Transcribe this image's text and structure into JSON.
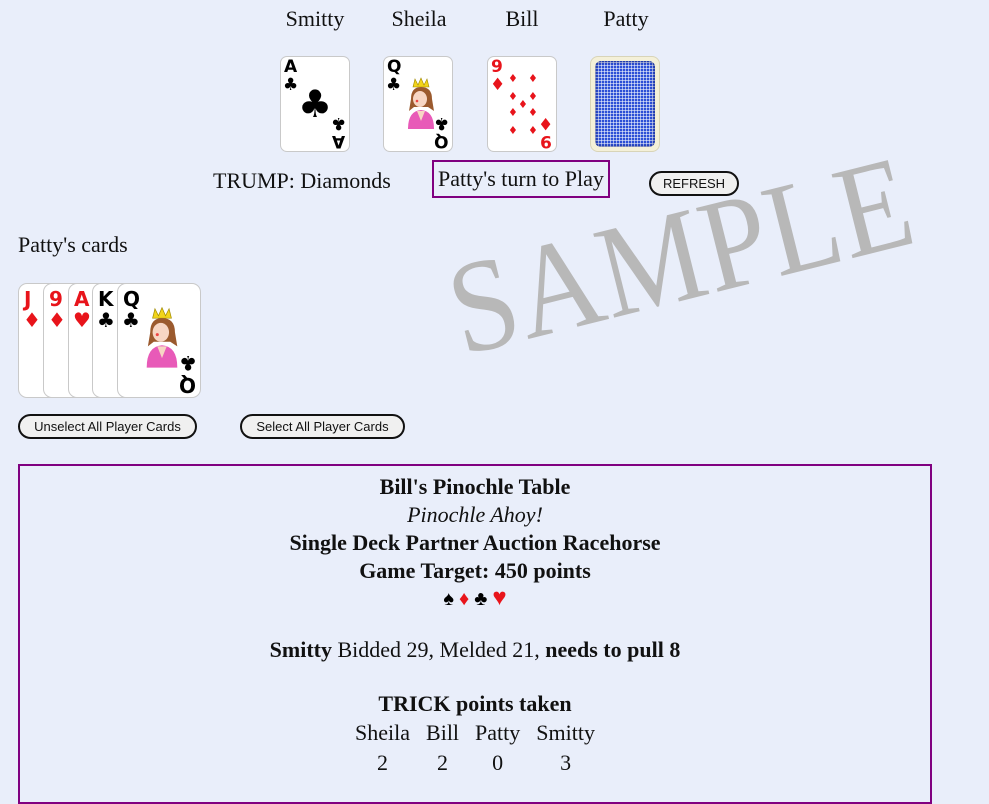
{
  "table": {
    "players": [
      "Smitty",
      "Sheila",
      "Bill",
      "Patty"
    ],
    "played_cards": [
      {
        "player": "Smitty",
        "rank": "A",
        "suit": "clubs",
        "suit_glyph": "♣",
        "color": "#000000"
      },
      {
        "player": "Sheila",
        "rank": "Q",
        "suit": "clubs",
        "suit_glyph": "♣",
        "color": "#000000"
      },
      {
        "player": "Bill",
        "rank": "9",
        "suit": "diamonds",
        "suit_glyph": "♦",
        "color": "#e8141b"
      },
      {
        "player": "Patty",
        "face_down": true
      }
    ]
  },
  "status": {
    "trump_label": "TRUMP: Diamonds",
    "turn_text": "Patty's turn to Play",
    "refresh_label": "REFRESH"
  },
  "hand": {
    "title": "Patty's cards",
    "cards": [
      {
        "rank": "J",
        "suit": "diamonds",
        "suit_glyph": "♦",
        "color": "#e8141b"
      },
      {
        "rank": "9",
        "suit": "diamonds",
        "suit_glyph": "♦",
        "color": "#e8141b"
      },
      {
        "rank": "A",
        "suit": "hearts",
        "suit_glyph": "♥",
        "color": "#e8141b"
      },
      {
        "rank": "K",
        "suit": "clubs",
        "suit_glyph": "♣",
        "color": "#000000"
      },
      {
        "rank": "Q",
        "suit": "clubs",
        "suit_glyph": "♣",
        "color": "#000000"
      }
    ],
    "unselect_label": "Unselect All Player Cards",
    "select_label": "Select All Player Cards"
  },
  "watermark": "SAMPLE",
  "info": {
    "title": "Bill's Pinochle Table",
    "subtitle": "Pinochle Ahoy!",
    "game_type": "Single Deck Partner Auction Racehorse",
    "target": "Game Target: 450 points",
    "suits": [
      {
        "glyph": "♠",
        "color": "#000000"
      },
      {
        "glyph": "♦",
        "color": "#e8141b"
      },
      {
        "glyph": "♣",
        "color": "#000000"
      },
      {
        "glyph": "♥",
        "color": "#e8141b"
      }
    ],
    "bid": {
      "bidder": "Smitty",
      "details": " Bidded 29, Melded 21, ",
      "needs": "needs to pull 8"
    },
    "trick_title": "TRICK points taken",
    "trick_players": [
      "Sheila",
      "Bill",
      "Patty",
      "Smitty"
    ],
    "trick_points": [
      "2",
      "2",
      "0",
      "3"
    ]
  },
  "colors": {
    "background": "#e9eefa",
    "accent_border": "#800080",
    "red_suit": "#e8141b",
    "watermark": "#b8b8b8"
  }
}
